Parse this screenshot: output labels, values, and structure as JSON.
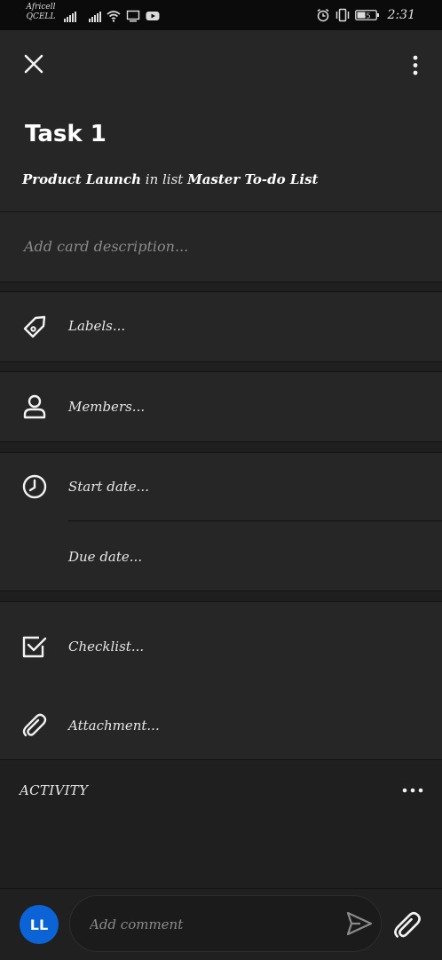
{
  "status_bar": {
    "carrier_1": "Africell",
    "carrier_2": "QCELL",
    "battery": "45",
    "time": "2:31"
  },
  "card": {
    "title": "Task 1",
    "board_name": "Product Launch",
    "in_list_text": "in list",
    "list_name": "Master To-do List",
    "description_placeholder": "Add card description..."
  },
  "rows": {
    "labels": "Labels...",
    "members": "Members...",
    "start_date": "Start date...",
    "due_date": "Due date...",
    "checklist": "Checklist...",
    "attachment": "Attachment..."
  },
  "activity": {
    "heading": "ACTIVITY"
  },
  "composer": {
    "avatar_initials": "LL",
    "placeholder": "Add comment",
    "avatar_color": "#0b63d6"
  },
  "colors": {
    "background": "#1f1f1f",
    "surface": "#262626",
    "accent": "#0b63d6"
  }
}
